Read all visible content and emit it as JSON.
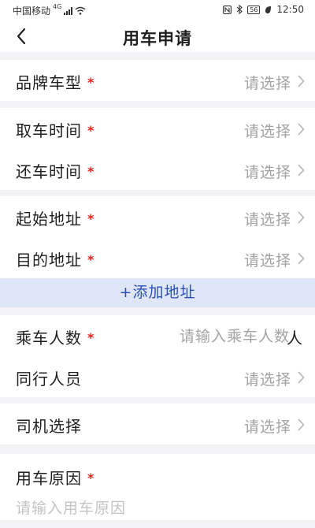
{
  "status": {
    "carrier": "中国移动",
    "network": "4G",
    "battery": "56",
    "time": "12:50"
  },
  "header": {
    "title": "用车申请"
  },
  "form": {
    "brand_model": {
      "label": "品牌车型",
      "value": "请选择"
    },
    "pickup_time": {
      "label": "取车时间",
      "value": "请选择"
    },
    "return_time": {
      "label": "还车时间",
      "value": "请选择"
    },
    "start_address": {
      "label": "起始地址",
      "value": "请选择"
    },
    "destination_address": {
      "label": "目的地址",
      "value": "请选择"
    },
    "add_address": "+添加地址",
    "passenger_count": {
      "label": "乘车人数",
      "placeholder": "请输入乘车人数",
      "value": "",
      "unit": "人"
    },
    "companions": {
      "label": "同行人员",
      "value": "请选择"
    },
    "driver": {
      "label": "司机选择",
      "value": "请选择"
    },
    "reason": {
      "label": "用车原因",
      "placeholder": "请输入用车原因",
      "value": ""
    },
    "required_mark": "*"
  },
  "colors": {
    "required": "#e1251b",
    "link": "#2c4fb4",
    "link_bg": "#dfe6f7",
    "placeholder": "#a3a3a3",
    "divider_bg": "#f3f3f5"
  }
}
